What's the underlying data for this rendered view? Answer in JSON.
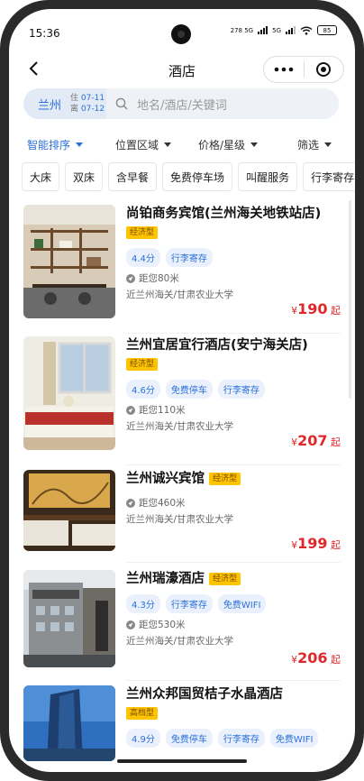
{
  "status": {
    "time": "15:36",
    "net_left": "278 5G",
    "net_right": "5G",
    "battery": "85"
  },
  "nav": {
    "title": "酒店"
  },
  "search": {
    "city": "兰州",
    "checkin_key": "住",
    "checkin": "07-11",
    "checkout_key": "离",
    "checkout": "07-12",
    "placeholder": "地名/酒店/关键词"
  },
  "filters": [
    {
      "label": "智能排序",
      "active": true
    },
    {
      "label": "位置区域",
      "active": false
    },
    {
      "label": "价格/星级",
      "active": false
    },
    {
      "label": "筛选",
      "active": false
    }
  ],
  "tags": [
    "大床",
    "双床",
    "含早餐",
    "免费停车场",
    "叫醒服务",
    "行李寄存"
  ],
  "hotels": [
    {
      "name": "尚铂商务宾馆(兰州海关地铁站店)",
      "badge": "经济型",
      "chips": [
        "4.4分",
        "行李寄存"
      ],
      "distance": "距您80米",
      "near": "近兰州海关/甘肃农业大学",
      "price": "190",
      "currency": "¥",
      "suffix": "起"
    },
    {
      "name": "兰州宜居宜行酒店(安宁海关店)",
      "badge": "经济型",
      "chips": [
        "4.6分",
        "免费停车",
        "行李寄存"
      ],
      "distance": "距您110米",
      "near": "近兰州海关/甘肃农业大学",
      "price": "207",
      "currency": "¥",
      "suffix": "起"
    },
    {
      "name": "兰州诚兴宾馆",
      "badge": "经济型",
      "chips": [],
      "distance": "距您460米",
      "near": "近兰州海关/甘肃农业大学",
      "price": "199",
      "currency": "¥",
      "suffix": "起"
    },
    {
      "name": "兰州瑞濠酒店",
      "badge": "经济型",
      "chips": [
        "4.3分",
        "行李寄存",
        "免费WIFI"
      ],
      "distance": "距您530米",
      "near": "近兰州海关/甘肃农业大学",
      "price": "206",
      "currency": "¥",
      "suffix": "起"
    },
    {
      "name": "兰州众邦国贸桔子水晶酒店",
      "badge": "高档型",
      "chips": [
        "4.9分",
        "免费停车",
        "行李寄存",
        "免费WIFI"
      ],
      "distance": "",
      "near": "",
      "price": "",
      "currency": "",
      "suffix": ""
    }
  ],
  "colors": {
    "accent": "#2a6fdb",
    "price": "#e0282b",
    "badge": "#ffc400"
  }
}
